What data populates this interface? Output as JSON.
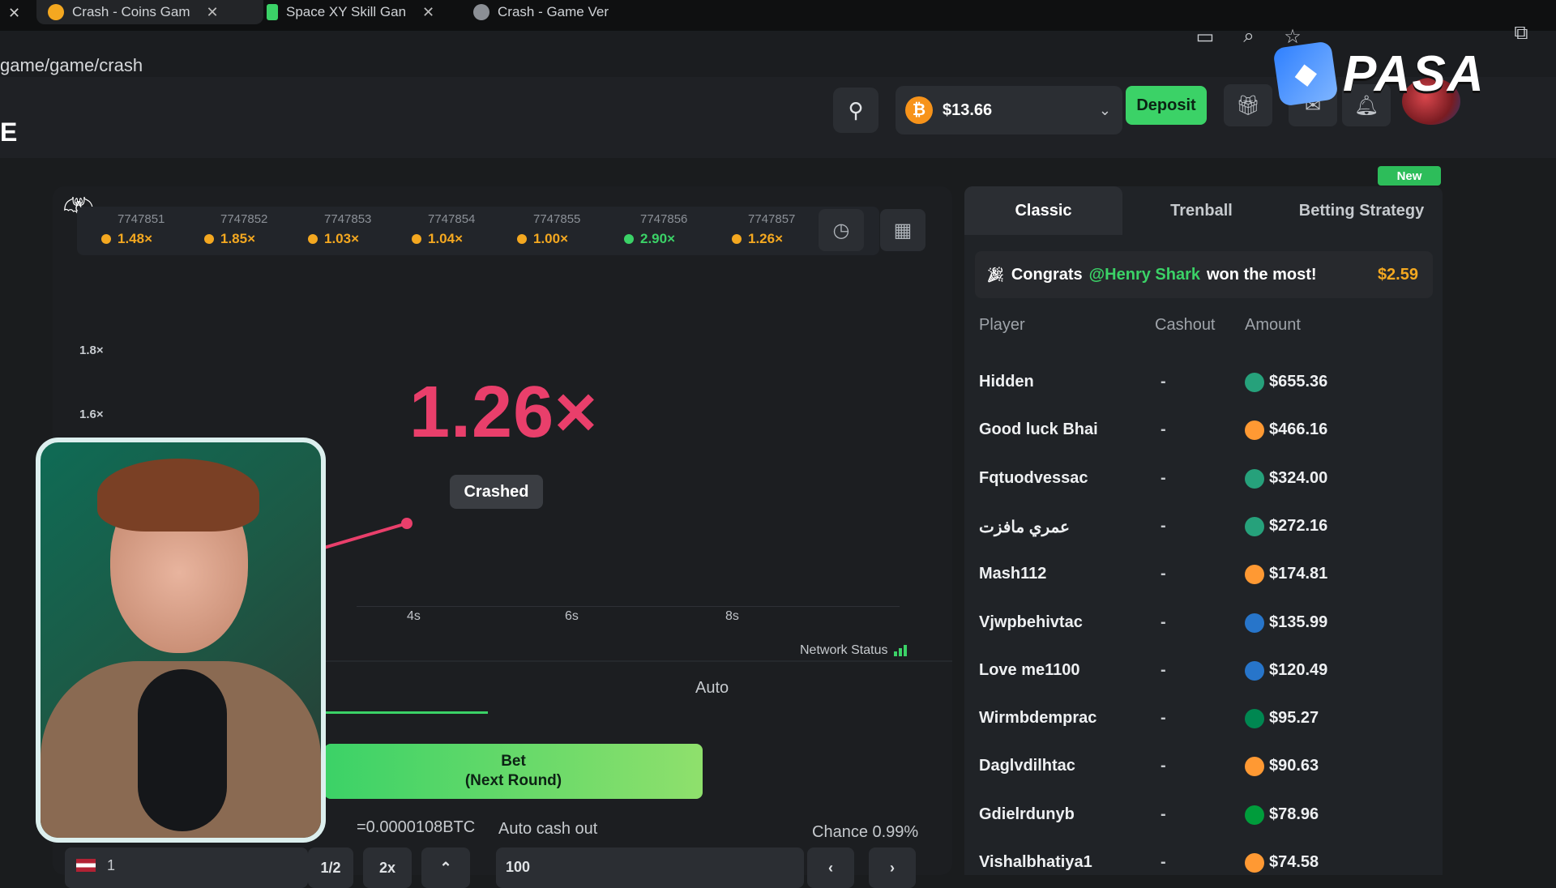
{
  "browser": {
    "tabs": [
      {
        "title": "Crash - Coins Gam",
        "active": true
      },
      {
        "title": "Space XY Skill Gan",
        "active": false
      },
      {
        "title": "Crash - Game Ver",
        "active": false
      }
    ],
    "url": "game/game/crash"
  },
  "header": {
    "site_initial": "E",
    "balance": "$13.66",
    "deposit_label": "Deposit",
    "logo_text": "PASA"
  },
  "game": {
    "history": [
      {
        "id": "7747851",
        "mult": "1.48×",
        "color": "#f4a820"
      },
      {
        "id": "7747852",
        "mult": "1.85×",
        "color": "#f4a820"
      },
      {
        "id": "7747853",
        "mult": "1.03×",
        "color": "#f4a820"
      },
      {
        "id": "7747854",
        "mult": "1.04×",
        "color": "#f4a820"
      },
      {
        "id": "7747855",
        "mult": "1.00×",
        "color": "#f4a820"
      },
      {
        "id": "7747856",
        "mult": "2.90×",
        "color": "#3bd267"
      },
      {
        "id": "7747857",
        "mult": "1.26×",
        "color": "#f4a820"
      }
    ],
    "y_ticks": [
      "1.8×",
      "1.6×"
    ],
    "x_ticks": [
      "4s",
      "6s",
      "8s"
    ],
    "current_multiplier": "1.26×",
    "status": "Crashed",
    "network_status": "Network Status",
    "accent": "#e93f6b"
  },
  "bet_panel": {
    "mode_auto": "Auto",
    "bet_line1": "Bet",
    "bet_line2": "(Next Round)",
    "btc_amount": "=0.0000108BTC",
    "auto_cash_label": "Auto cash out",
    "chance": "Chance 0.99%",
    "amount_value": "1",
    "half_label": "1/2",
    "double_label": "2x",
    "cashout_value": "100"
  },
  "side": {
    "tabs": [
      "Classic",
      "Trenball",
      "Betting Strategy"
    ],
    "new_badge": "New",
    "congrats": {
      "prefix": "Congrats",
      "user": "@Henry Shark",
      "suffix": "won the most!",
      "amount": "$2.59"
    },
    "columns": {
      "player": "Player",
      "cashout": "Cashout",
      "amount": "Amount"
    },
    "players": [
      {
        "name": "Hidden",
        "cashout": "-",
        "amount": "$655.36",
        "icon": "usdt-icon",
        "icon_color": "#26a17b"
      },
      {
        "name": "Good luck Bhai",
        "cashout": "-",
        "amount": "$466.16",
        "icon": "india-flag-icon",
        "icon_color": "#ff9933"
      },
      {
        "name": "Fqtuodvessac",
        "cashout": "-",
        "amount": "$324.00",
        "icon": "usdt-icon",
        "icon_color": "#26a17b"
      },
      {
        "name": "عمري مافزت",
        "cashout": "-",
        "amount": "$272.16",
        "icon": "usdt-icon",
        "icon_color": "#26a17b"
      },
      {
        "name": "Mash112",
        "cashout": "-",
        "amount": "$174.81",
        "icon": "india-flag-icon",
        "icon_color": "#ff9933"
      },
      {
        "name": "Vjwpbehivtac",
        "cashout": "-",
        "amount": "$135.99",
        "icon": "usdc-icon",
        "icon_color": "#2775ca"
      },
      {
        "name": "Love me1100",
        "cashout": "-",
        "amount": "$120.49",
        "icon": "usdc-icon",
        "icon_color": "#2775ca"
      },
      {
        "name": "Wirmbdemprac",
        "cashout": "-",
        "amount": "$95.27",
        "icon": "nigeria-flag-icon",
        "icon_color": "#008751"
      },
      {
        "name": "Daglvdilhtac",
        "cashout": "-",
        "amount": "$90.63",
        "icon": "india-flag-icon",
        "icon_color": "#ff9933"
      },
      {
        "name": "Gdielrdunyb",
        "cashout": "-",
        "amount": "$78.96",
        "icon": "brazil-flag-icon",
        "icon_color": "#009c3b"
      },
      {
        "name": "Vishalbhatiya1",
        "cashout": "-",
        "amount": "$74.58",
        "icon": "india-flag-icon",
        "icon_color": "#ff9933"
      }
    ]
  }
}
